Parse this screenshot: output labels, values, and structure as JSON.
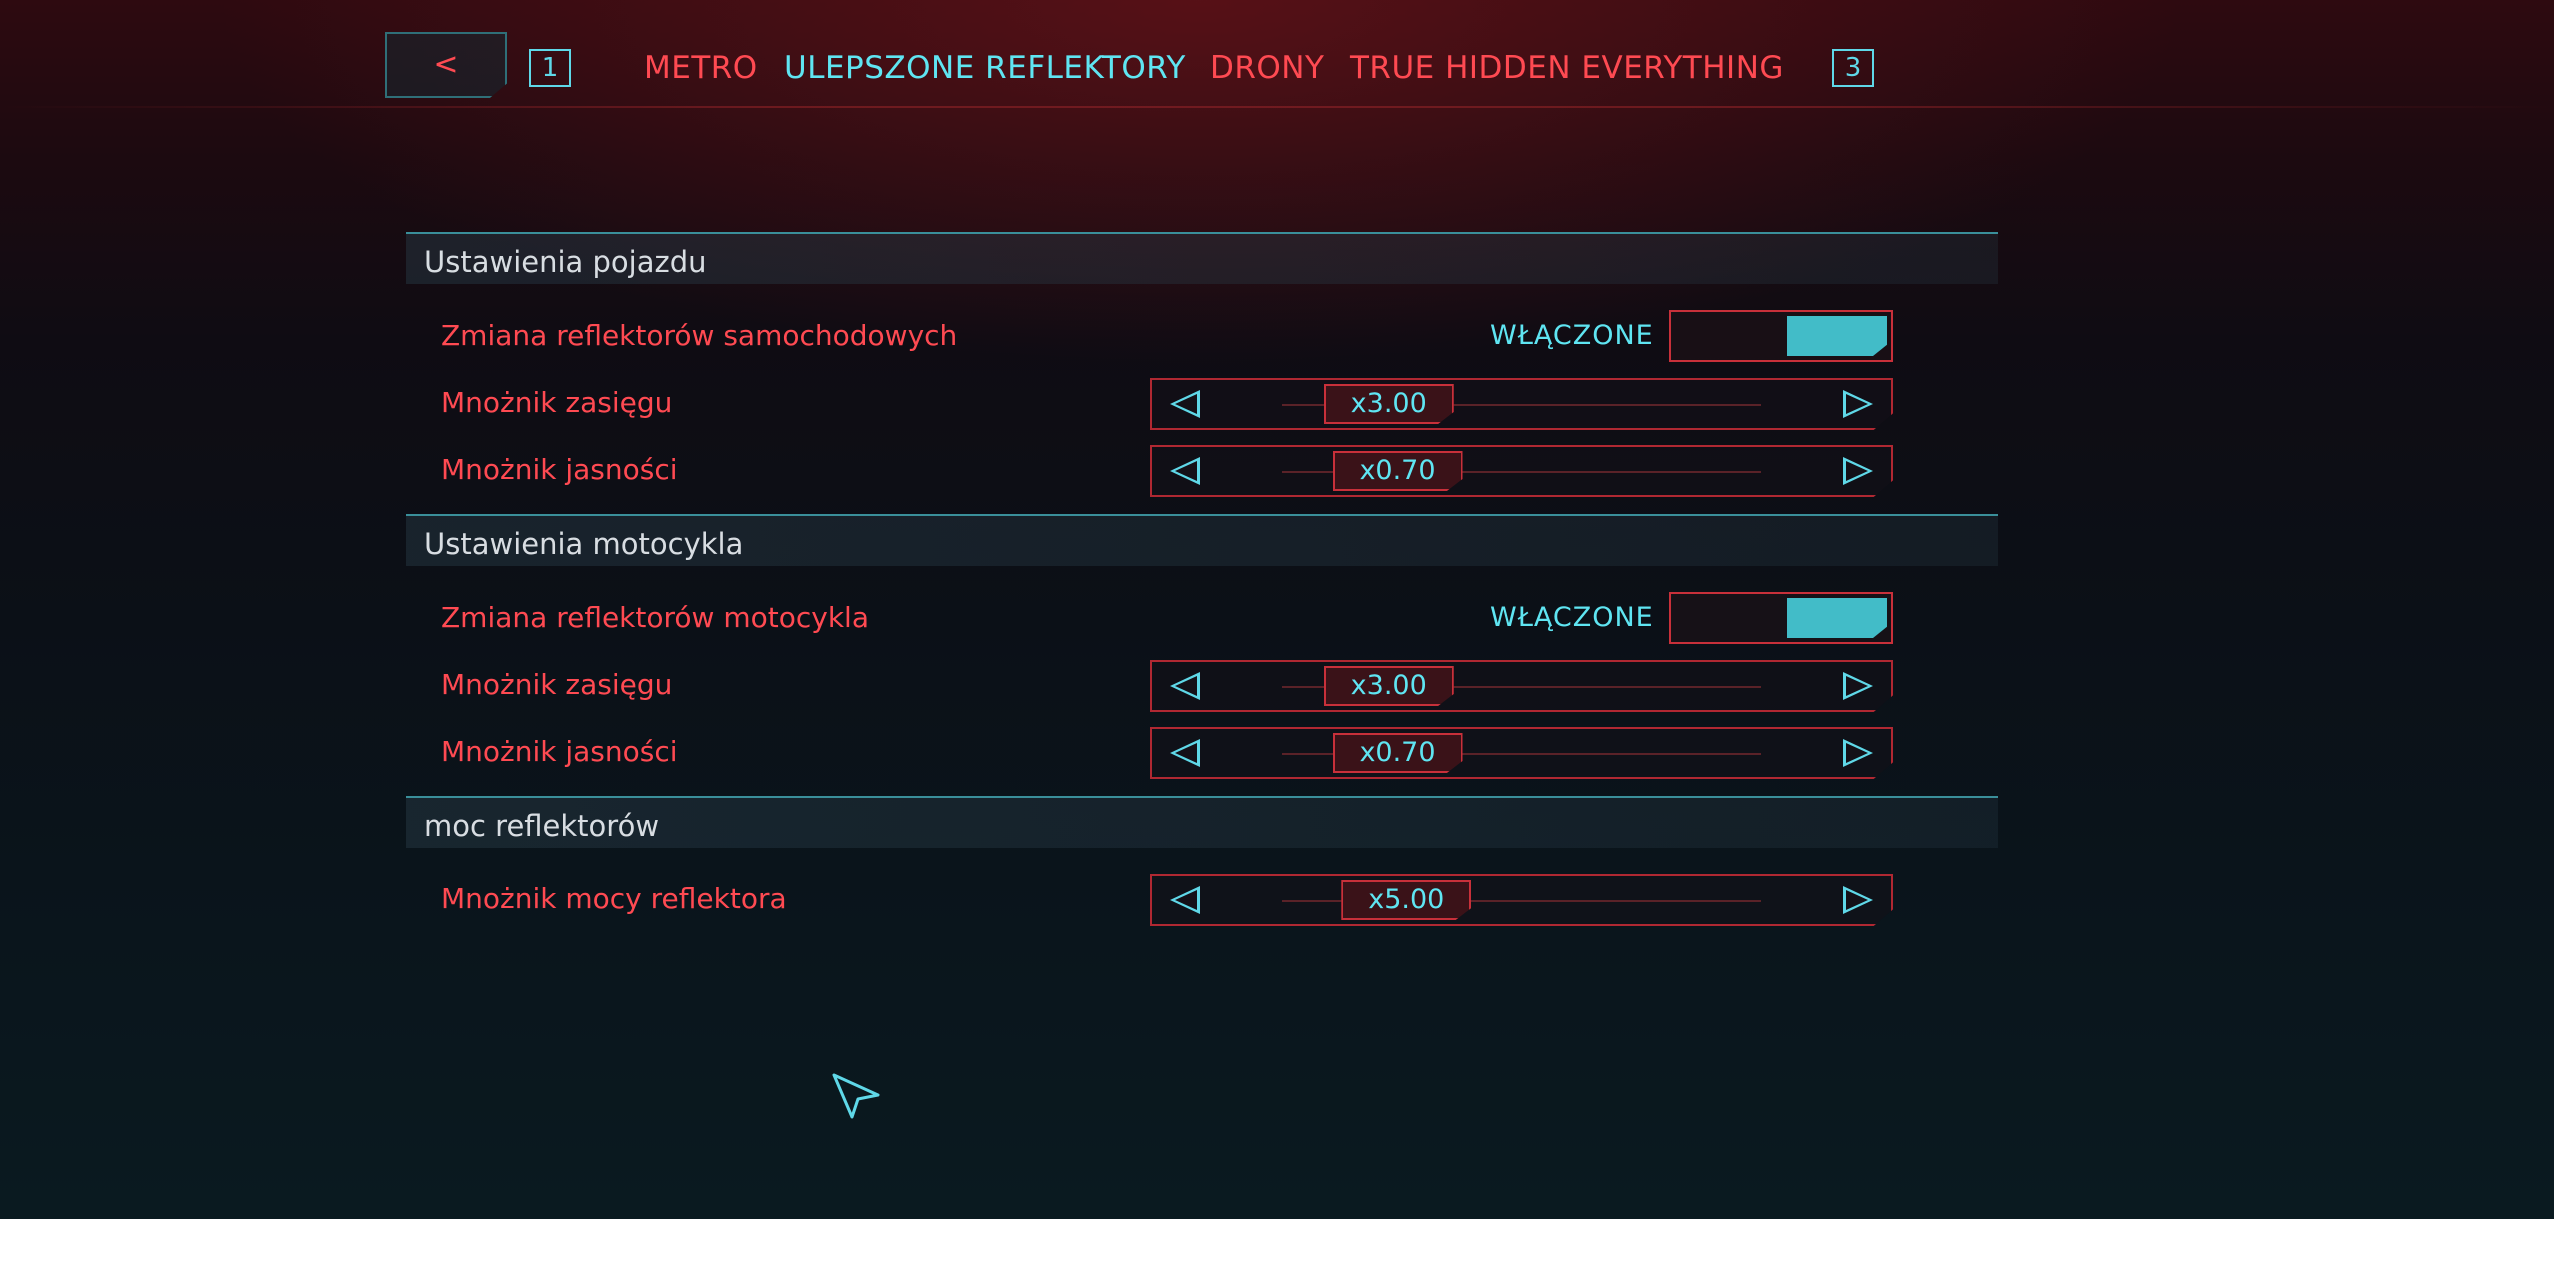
{
  "nav": {
    "back_label": "<",
    "prev_key": "1",
    "next_key": "3",
    "tabs": [
      {
        "label": "METRO",
        "active": false
      },
      {
        "label": "ULEPSZONE REFLEKTORY",
        "active": true
      },
      {
        "label": "DRONY",
        "active": false
      },
      {
        "label": "TRUE HIDDEN EVERYTHING",
        "active": false
      }
    ]
  },
  "sections": [
    {
      "title": "Ustawienia pojazdu",
      "rows": [
        {
          "type": "toggle",
          "label": "Zmiana reflektorów samochodowych",
          "state": "WŁĄCZONE",
          "on": true
        },
        {
          "type": "slider",
          "label": "Mnożnik zasięgu",
          "value": "x3.00",
          "fraction": 0.04
        },
        {
          "type": "slider",
          "label": "Mnożnik jasności",
          "value": "x0.70",
          "fraction": 0.07
        }
      ]
    },
    {
      "title": "Ustawienia motocykla",
      "rows": [
        {
          "type": "toggle",
          "label": "Zmiana reflektorów motocykla",
          "state": "WŁĄCZONE",
          "on": true
        },
        {
          "type": "slider",
          "label": "Mnożnik zasięgu",
          "value": "x3.00",
          "fraction": 0.04
        },
        {
          "type": "slider",
          "label": "Mnożnik jasności",
          "value": "x0.70",
          "fraction": 0.07
        }
      ]
    },
    {
      "title": "moc reflektorów",
      "rows": [
        {
          "type": "slider",
          "label": "Mnożnik mocy reflektora",
          "value": "x5.00",
          "fraction": 0.1
        }
      ]
    }
  ],
  "colors": {
    "accent_red": "#ff4a52",
    "accent_cyan": "#5fe5f2",
    "toggle_fill": "#42bcc8"
  }
}
